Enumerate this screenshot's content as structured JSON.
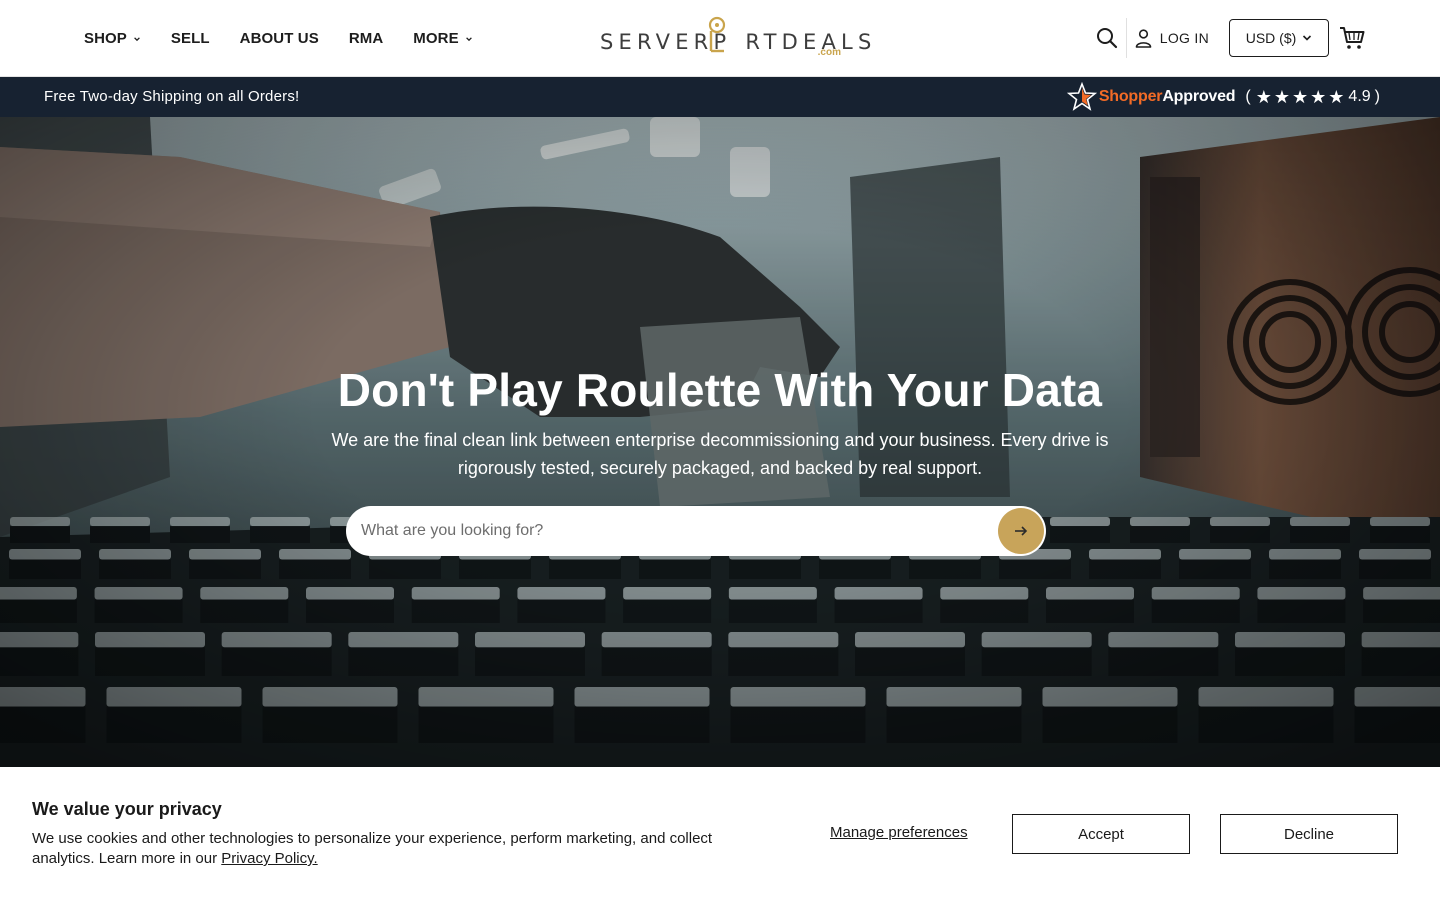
{
  "nav": {
    "items": [
      {
        "label": "SHOP",
        "has_dropdown": true
      },
      {
        "label": "SELL",
        "has_dropdown": false
      },
      {
        "label": "ABOUT US",
        "has_dropdown": false
      },
      {
        "label": "RMA",
        "has_dropdown": false
      },
      {
        "label": "MORE",
        "has_dropdown": true
      }
    ]
  },
  "logo": {
    "text_a": "SERVERP",
    "text_b": "RTDEALS",
    "suffix": ".com",
    "accent_color": "#c9a44c"
  },
  "header": {
    "search_icon": "search-icon",
    "login_label": "LOG IN",
    "currency_label": "USD ($)",
    "cart_icon": "cart-icon"
  },
  "promo": {
    "text": "Free Two-day Shipping on all Orders!",
    "rating_brand_a": "Shopper",
    "rating_brand_b": "Approved",
    "rating_open": "(",
    "rating_value": "4.9",
    "rating_close": ")",
    "stars": 5
  },
  "hero": {
    "title": "Don't Play Roulette With Your Data",
    "subtitle": "We are the final clean link between enterprise decommissioning and your business. Every drive is rigorously tested, securely packaged, and backed by real support.",
    "search_placeholder": "What are you looking for?",
    "button_color": "#c8a45a"
  },
  "cookie": {
    "title": "We value your privacy",
    "text": "We use cookies and other technologies to personalize your experience, perform marketing, and collect analytics. Learn more in our ",
    "link": "Privacy Policy.",
    "manage": "Manage preferences",
    "accept": "Accept",
    "decline": "Decline"
  },
  "colors": {
    "promo_bg": "#172231",
    "brand_orange": "#f26b26"
  }
}
